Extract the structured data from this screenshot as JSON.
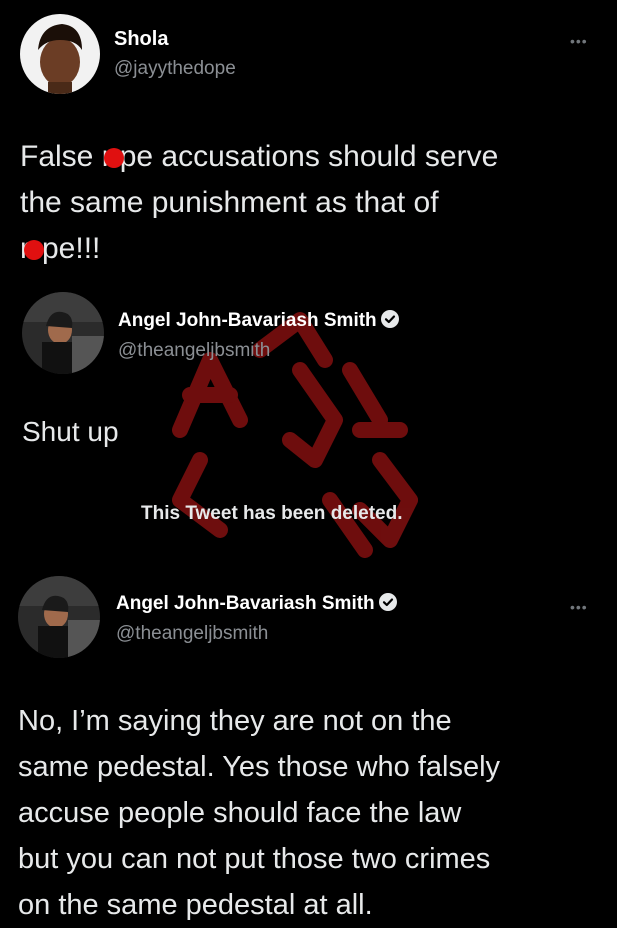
{
  "tweet1": {
    "name": "Shola",
    "handle": "@jayythedope",
    "more": "•••",
    "text_a": "False r",
    "text_b": "pe accusations should serve",
    "text_c": "the same punishment as that of",
    "text_d": "r",
    "text_e": "pe!!!"
  },
  "tweet2": {
    "name": "Angel John-Bavariash Smith",
    "handle": "@theangeljbsmith",
    "text": "Shut up"
  },
  "deleted": {
    "text": "This Tweet has been deleted."
  },
  "tweet3": {
    "name": "Angel John-Bavariash Smith",
    "handle": "@theangeljbsmith",
    "more": "•••",
    "line1": "No, I’m saying they are not on the",
    "line2": "same pedestal. Yes those who falsely",
    "line3": "accuse people should face the law",
    "line4": "but you can not put those two crimes",
    "line5": "on the same pedestal at all."
  },
  "colors": {
    "background": "#000000",
    "text": "#e7e9ea",
    "handle": "#8b8f94",
    "redaction": "#e01010",
    "watermark": "#8b1010"
  },
  "icons": {
    "verified": "verified-badge-icon",
    "more": "more-options-icon"
  }
}
